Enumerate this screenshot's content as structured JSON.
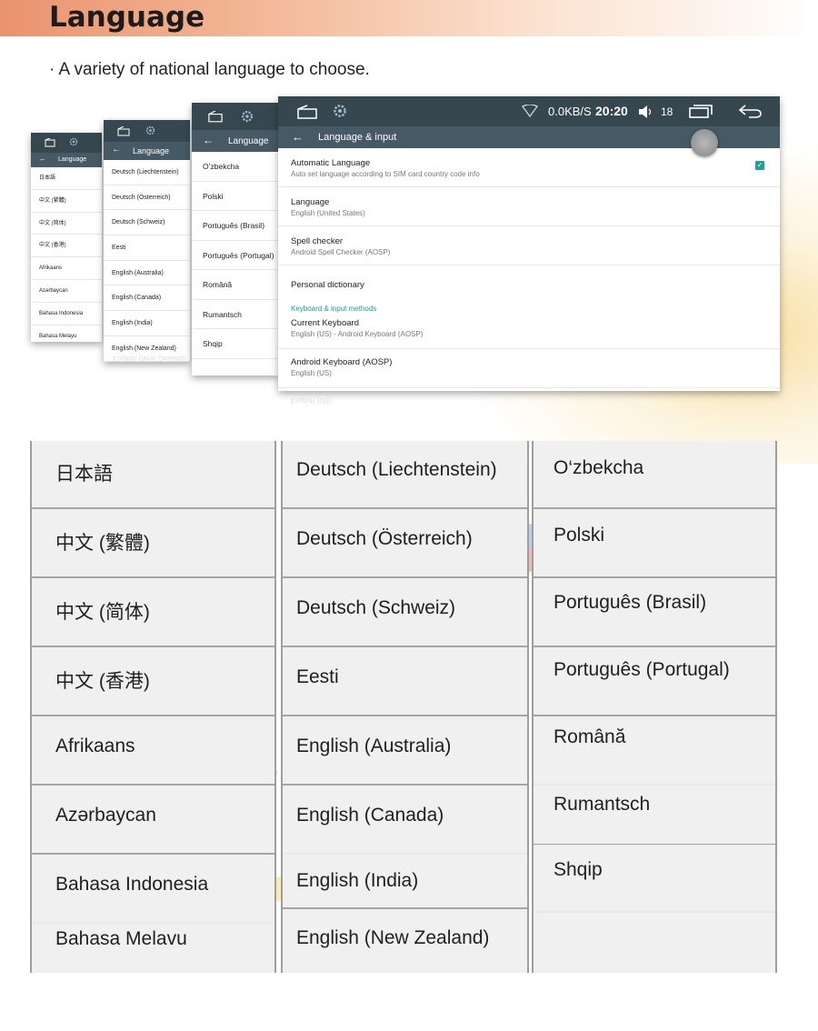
{
  "header": {
    "title": "Language",
    "subtitle": "· A variety of national language to choose."
  },
  "screens": {
    "screen1": {
      "title": "Language",
      "items": [
        "日本語",
        "中文 (繁體)",
        "中文 (简体)",
        "中文 (香港)",
        "Afrikaans",
        "Azərbaycan",
        "Bahasa Indonesia",
        "Bahasa Melayu"
      ]
    },
    "screen2": {
      "title": "Language",
      "items": [
        "Deutsch (Liechtenstein)",
        "Deutsch (Österreich)",
        "Deutsch (Schweiz)",
        "Eesti",
        "English (Australia)",
        "English (Canada)",
        "English (India)",
        "English (New Zealand)"
      ]
    },
    "screen3": {
      "title": "Language",
      "items": [
        "O’zbekcha",
        "Polski",
        "Português (Brasil)",
        "Português (Portugal)",
        "Română",
        "Rumantsch",
        "Shqip"
      ]
    },
    "screen4": {
      "title": "Language & input",
      "status": {
        "speed": "0.0KB/S",
        "time": "20:20",
        "volume": "18"
      },
      "settings": [
        {
          "title": "Automatic Language",
          "summary": "Auto set language according to SIM card country code info"
        },
        {
          "title": "Language",
          "summary": "English (United States)"
        },
        {
          "title": "Spell checker",
          "summary": "Android Spell Checker (AOSP)"
        },
        {
          "title": "Personal dictionary"
        }
      ],
      "category": "Keyboard & input methods",
      "keyboards": [
        {
          "title": "Current Keyboard",
          "summary": "English (US) - Android Keyboard (AOSP)"
        },
        {
          "title": "Android Keyboard (AOSP)",
          "summary": "English (US)"
        }
      ]
    }
  },
  "grid": {
    "column1": [
      "日本語",
      "中文 (繁體)",
      "中文 (简体)",
      "中文 (香港)",
      "Afrikaans",
      "Azərbaycan",
      "Bahasa Indonesia",
      "Bahasa Melavu"
    ],
    "column2": [
      "Deutsch (Liechtenstein)",
      "Deutsch (Österreich)",
      "Deutsch (Schweiz)",
      "Eesti",
      "English (Australia)",
      "English (Canada)",
      "English (India)",
      "English (New Zealand)"
    ],
    "column3": [
      "O‘zbekcha",
      "Polski",
      "Português (Brasil)",
      "Português (Portugal)",
      "Română",
      "Rumantsch",
      "Shqip",
      ""
    ]
  },
  "colors": {
    "status_bar": "#37474f",
    "app_bar": "#455a64",
    "accent": "#1aa293",
    "banner": "#e9936d"
  },
  "icons": [
    "home-icon",
    "settings-gear-icon",
    "wifi-icon",
    "volume-icon",
    "recent-apps-icon",
    "return-icon",
    "back-arrow-icon",
    "checkbox-checked-icon"
  ]
}
